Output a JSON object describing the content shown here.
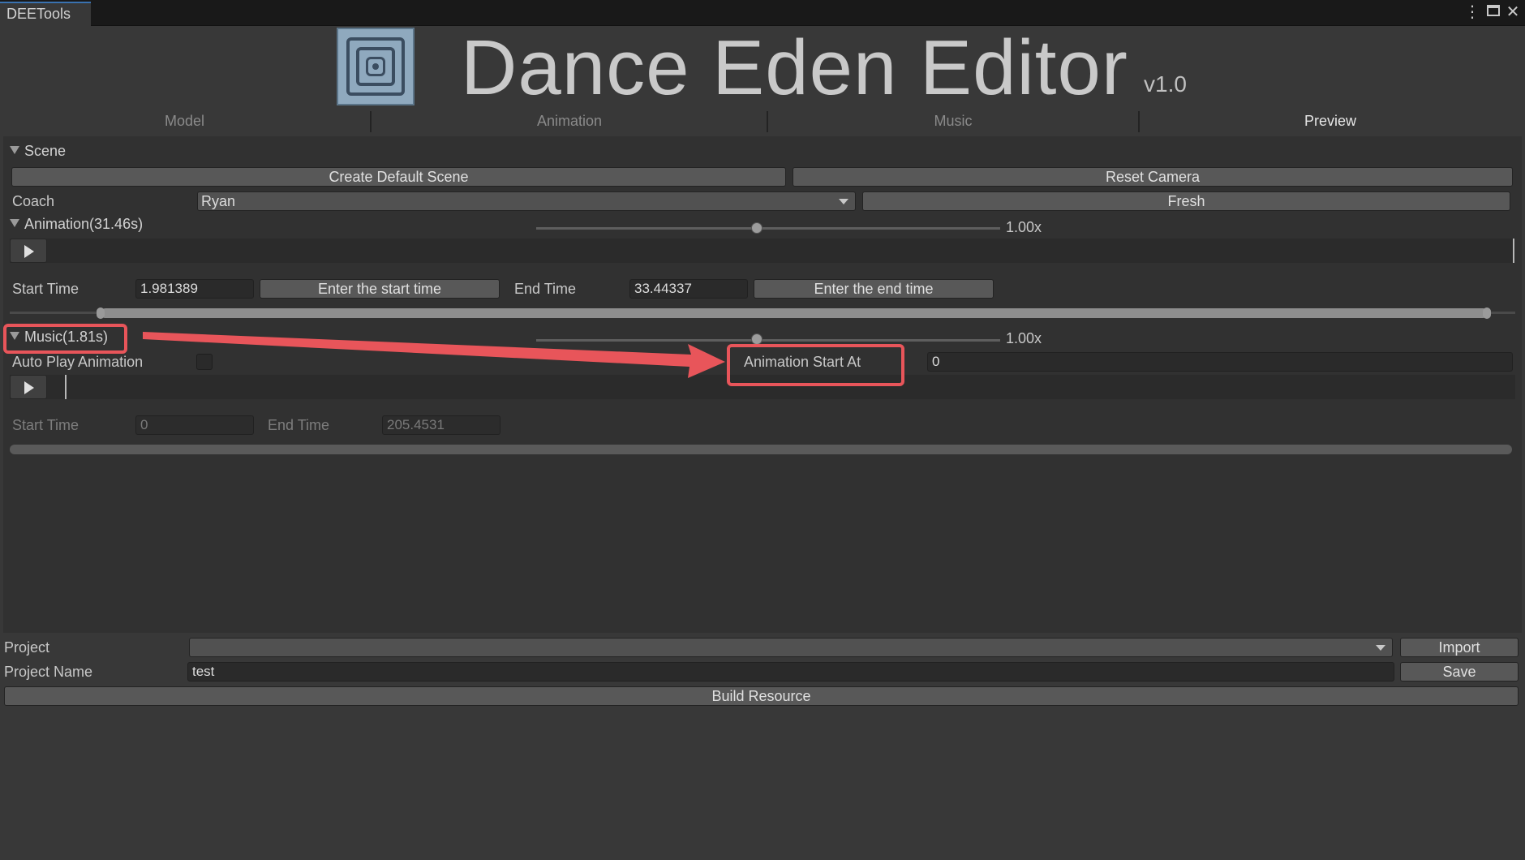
{
  "window": {
    "tab_title": "DEETools",
    "icons": [
      "more-vertical-icon",
      "maximize-icon",
      "close-icon"
    ]
  },
  "header": {
    "title": "Dance Eden Editor",
    "version": "v1.0",
    "logo_icon": "maze-logo-icon"
  },
  "tabs": [
    {
      "label": "Model",
      "active": false
    },
    {
      "label": "Animation",
      "active": false
    },
    {
      "label": "Music",
      "active": false
    },
    {
      "label": "Preview",
      "active": true
    }
  ],
  "scene": {
    "label": "Scene",
    "create_default_scene": "Create Default Scene",
    "reset_camera": "Reset Camera",
    "coach_label": "Coach",
    "coach_value": "Ryan",
    "fresh": "Fresh"
  },
  "animation": {
    "label": "Animation(31.46s)",
    "speed": "1.00x",
    "speed_fraction": 0.5,
    "start_time_label": "Start Time",
    "start_time_value": "1.981389",
    "enter_start": "Enter the start time",
    "end_time_label": "End Time",
    "end_time_value": "33.44337",
    "enter_end": "Enter the end time"
  },
  "music": {
    "label": "Music(1.81s)",
    "speed": "1.00x",
    "auto_play_label": "Auto Play Animation",
    "auto_play_checked": false,
    "anim_start_label": "Animation Start At",
    "anim_start_value": "0",
    "start_time_label": "Start Time",
    "start_time_value": "0",
    "end_time_label": "End Time",
    "end_time_value": "205.4531"
  },
  "project": {
    "project_label": "Project",
    "project_value": "",
    "import": "Import",
    "name_label": "Project Name",
    "name_value": "test",
    "save": "Save",
    "build": "Build Resource"
  },
  "colors": {
    "annotation": "#e8555a",
    "background": "#383838",
    "panel": "#313131"
  }
}
